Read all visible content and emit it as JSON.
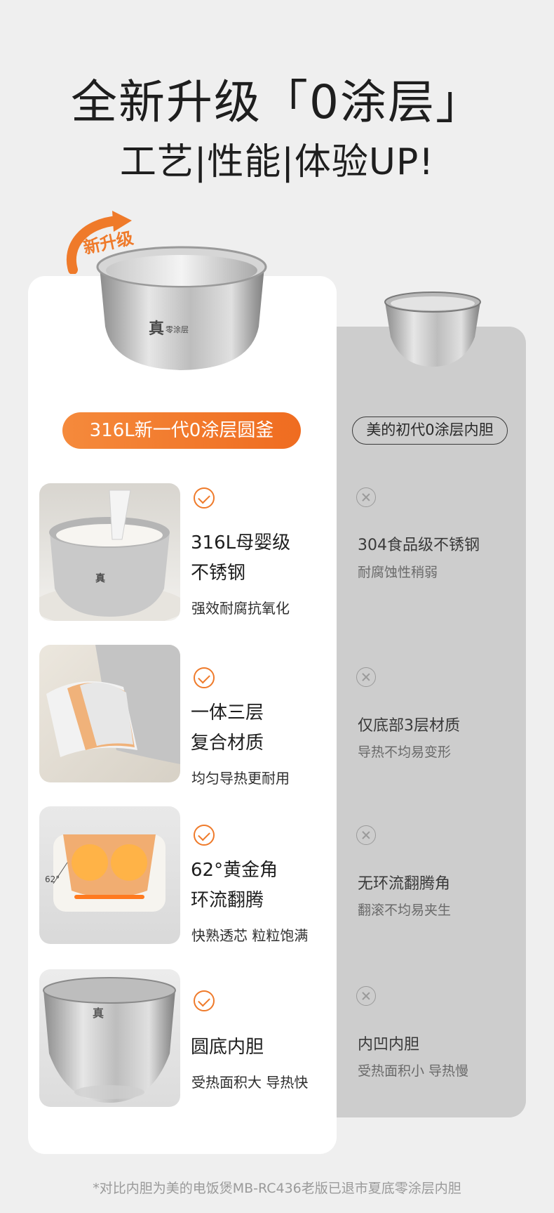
{
  "header": {
    "title_line1": "全新升级「0涂层」",
    "title_line2": "工艺|性能|体验UP!"
  },
  "badge": {
    "text": "新升级",
    "color": "#ef7a2a"
  },
  "products": {
    "new_label": "316L新一代0涂层圆釜",
    "old_label": "美的初代0涂层内胆",
    "pot_logo": "真",
    "pot_logo_sub": "零涂层"
  },
  "features": [
    {
      "title_l1": "316L母婴级",
      "title_l2": "不锈钢",
      "desc": "强效耐腐抗氧化",
      "old_title": "304食品级不锈钢",
      "old_desc": "耐腐蚀性稍弱",
      "icon": "rice-pot-photo"
    },
    {
      "title_l1": "一体三层",
      "title_l2": "复合材质",
      "desc": "均匀导热更耐用",
      "old_title": "仅底部3层材质",
      "old_desc": "导热不均易变形",
      "icon": "layer-cutaway-photo"
    },
    {
      "title_l1": "62°黄金角",
      "title_l2": "环流翻腾",
      "desc": "快熟透芯 粒粒饱满",
      "old_title": "无环流翻腾角",
      "old_desc": "翻滚不均易夹生",
      "angle_label": "62°",
      "icon": "boiling-cooker-photo"
    },
    {
      "title_l1": "圆底内胆",
      "title_l2": "",
      "desc": "受热面积大 导热快",
      "old_title": "内凹内胆",
      "old_desc": "受热面积小 导热慢",
      "icon": "round-bottom-pot-photo"
    }
  ],
  "footnote": "*对比内胆为美的电饭煲MB-RC436老版已退市夏底零涂层内胆",
  "colors": {
    "accent": "#ef7a2a",
    "card_bg": "#ffffff",
    "compare_bg": "#cdcdcd",
    "page_bg": "#efefef"
  }
}
